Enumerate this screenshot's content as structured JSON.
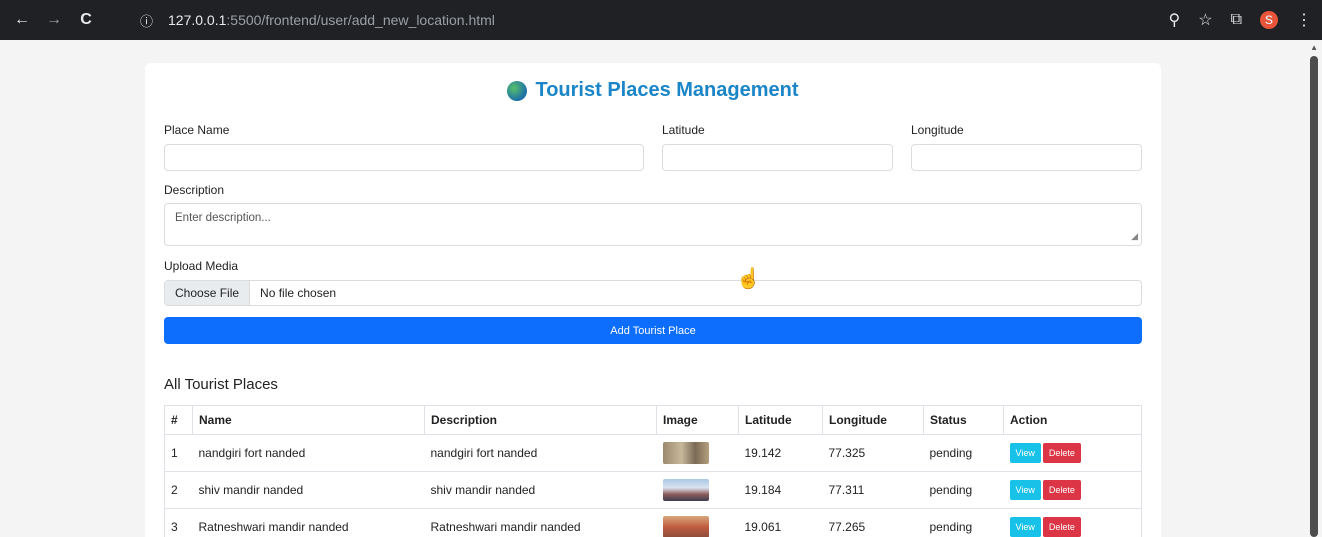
{
  "browser": {
    "back_icon": "←",
    "forward_icon": "→",
    "reload_icon": "C",
    "info_icon": "ⓘ",
    "url_host": "127.0.0.1",
    "url_path": ":5500/frontend/user/add_new_location.html",
    "zoom_icon": "⚲",
    "star_icon": "☆",
    "extensions_icon": "⧉",
    "profile_initial": "s",
    "menu_icon": "⋮"
  },
  "page": {
    "title": "Tourist Places Management"
  },
  "form": {
    "place_name_label": "Place Name",
    "latitude_label": "Latitude",
    "longitude_label": "Longitude",
    "description_label": "Description",
    "description_placeholder": "Enter description...",
    "upload_label": "Upload Media",
    "choose_file_label": "Choose File",
    "no_file_text": "No file chosen",
    "submit_label": "Add Tourist Place"
  },
  "table": {
    "section_title": "All Tourist Places",
    "headers": [
      "#",
      "Name",
      "Description",
      "Image",
      "Latitude",
      "Longitude",
      "Status",
      "Action"
    ],
    "view_label": "View",
    "delete_label": "Delete",
    "rows": [
      {
        "num": "1",
        "name": "nandgiri fort nanded",
        "description": "nandgiri fort nanded",
        "latitude": "19.142",
        "longitude": "77.325",
        "status": "pending"
      },
      {
        "num": "2",
        "name": "shiv mandir nanded",
        "description": "shiv mandir nanded",
        "latitude": "19.184",
        "longitude": "77.311",
        "status": "pending"
      },
      {
        "num": "3",
        "name": "Ratneshwari mandir nanded",
        "description": "Ratneshwari mandir nanded",
        "latitude": "19.061",
        "longitude": "77.265",
        "status": "pending"
      }
    ]
  },
  "colors": {
    "title": "#1a85c7",
    "primary_button": "#0d6efd",
    "view_button": "#17c1e8",
    "delete_button": "#dc3545"
  }
}
